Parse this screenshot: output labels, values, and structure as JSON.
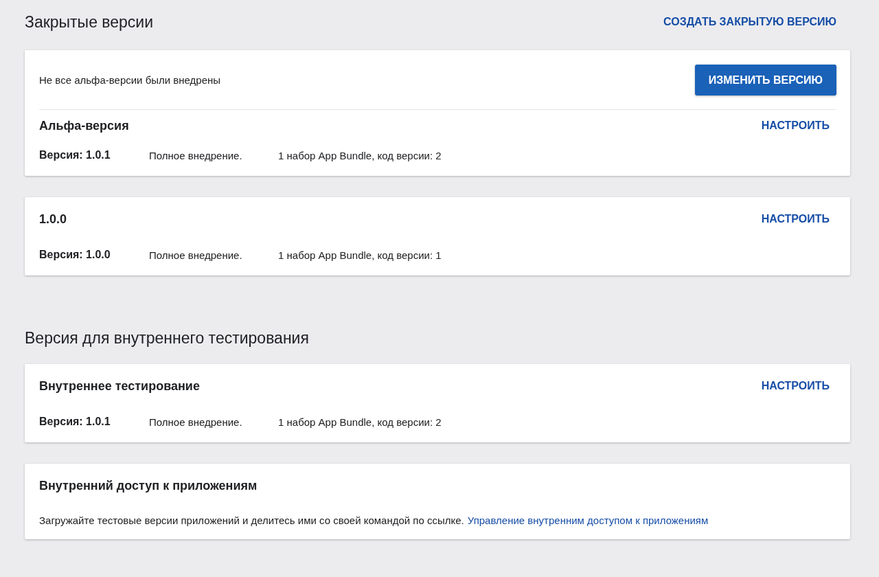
{
  "closed_section": {
    "title": "Закрытые версии",
    "action": "СОЗДАТЬ ЗАКРЫТУЮ ВЕРСИЮ"
  },
  "closed_tracks": [
    {
      "notice": "Не все альфа-версии были внедрены",
      "notice_button": "ИЗМЕНИТЬ ВЕРСИЮ",
      "name": "Альфа-версия",
      "action": "НАСТРОИТЬ",
      "version": "Версия: 1.0.1",
      "rollout": "Полное внедрение.",
      "bundle": "1 набор App Bundle, код версии: 2"
    },
    {
      "name": "1.0.0",
      "action": "НАСТРОИТЬ",
      "version": "Версия: 1.0.0",
      "rollout": "Полное внедрение.",
      "bundle": "1 набор App Bundle, код версии: 1"
    }
  ],
  "internal_section": {
    "title": "Версия для внутреннего тестирования"
  },
  "internal_tracks": [
    {
      "name": "Внутреннее тестирование",
      "action": "НАСТРОИТЬ",
      "version": "Версия: 1.0.1",
      "rollout": "Полное внедрение.",
      "bundle": "1 набор App Bundle, код версии: 2"
    }
  ],
  "internal_sharing": {
    "title": "Внутренний доступ к приложениям",
    "text": "Загружайте тестовые версии приложений и делитесь ими со своей командой по ссылке.",
    "link": "Управление внутренним доступом к приложениям"
  }
}
